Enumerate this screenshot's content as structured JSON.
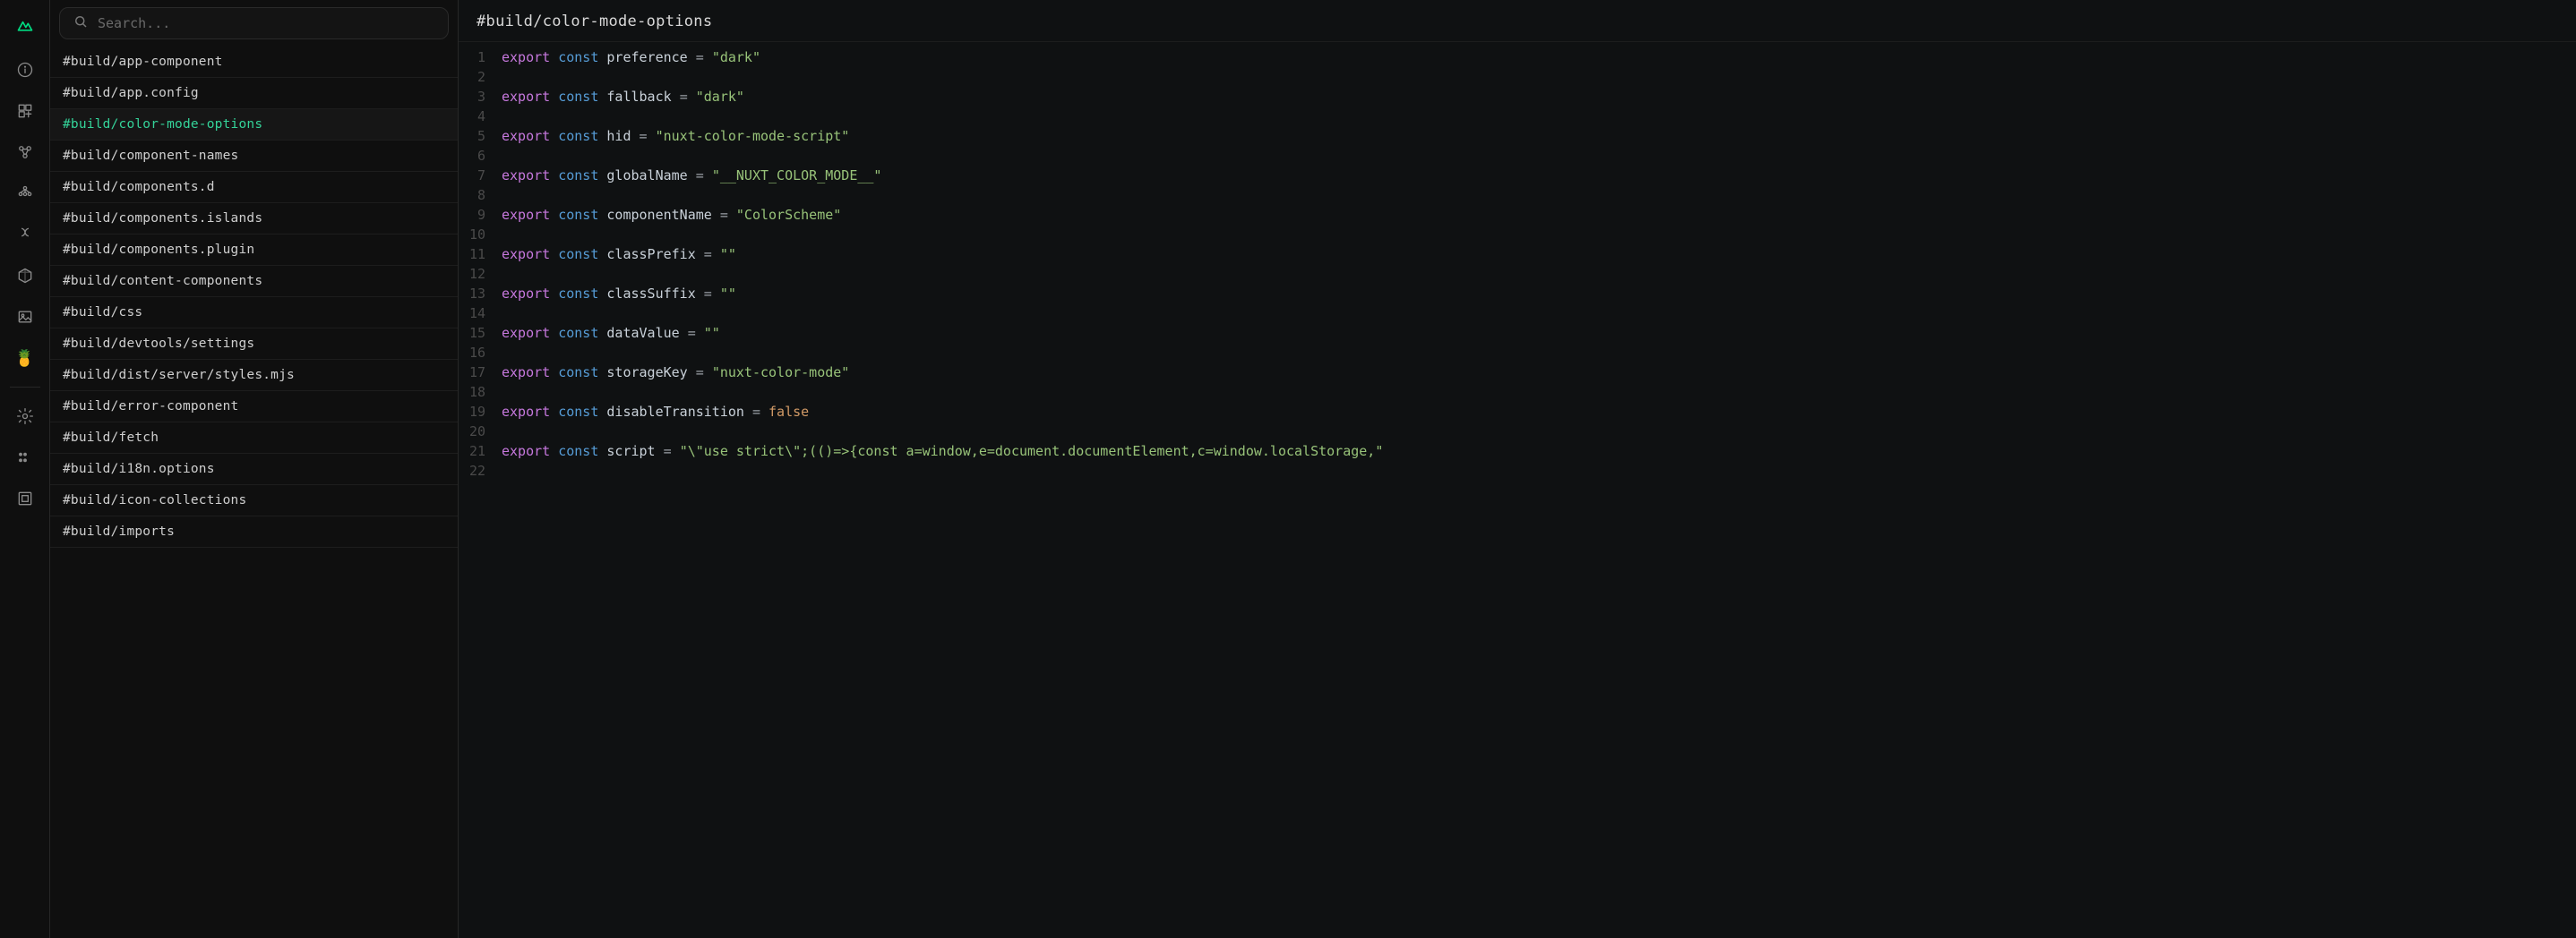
{
  "search": {
    "placeholder": "Search..."
  },
  "rail": {
    "items": [
      {
        "name": "info-icon"
      },
      {
        "name": "pages-icon"
      },
      {
        "name": "components-icon"
      },
      {
        "name": "modules-icon"
      },
      {
        "name": "hooks-icon"
      },
      {
        "name": "files-icon"
      },
      {
        "name": "assets-icon"
      },
      {
        "name": "pinia-icon"
      }
    ],
    "bottom": [
      {
        "name": "settings-icon"
      },
      {
        "name": "more-icon"
      },
      {
        "name": "inspect-icon"
      }
    ]
  },
  "files": [
    {
      "label": "#build/app-component",
      "active": false
    },
    {
      "label": "#build/app.config",
      "active": false
    },
    {
      "label": "#build/color-mode-options",
      "active": true
    },
    {
      "label": "#build/component-names",
      "active": false
    },
    {
      "label": "#build/components.d",
      "active": false
    },
    {
      "label": "#build/components.islands",
      "active": false
    },
    {
      "label": "#build/components.plugin",
      "active": false
    },
    {
      "label": "#build/content-components",
      "active": false
    },
    {
      "label": "#build/css",
      "active": false
    },
    {
      "label": "#build/devtools/settings",
      "active": false
    },
    {
      "label": "#build/dist/server/styles.mjs",
      "active": false
    },
    {
      "label": "#build/error-component",
      "active": false
    },
    {
      "label": "#build/fetch",
      "active": false
    },
    {
      "label": "#build/i18n.options",
      "active": false
    },
    {
      "label": "#build/icon-collections",
      "active": false
    },
    {
      "label": "#build/imports",
      "active": false
    }
  ],
  "breadcrumb": "#build/color-mode-options",
  "code": {
    "declarations": [
      {
        "name": "preference",
        "type": "string",
        "value": "dark"
      },
      {
        "name": "fallback",
        "type": "string",
        "value": "dark"
      },
      {
        "name": "hid",
        "type": "string",
        "value": "nuxt-color-mode-script"
      },
      {
        "name": "globalName",
        "type": "string",
        "value": "__NUXT_COLOR_MODE__"
      },
      {
        "name": "componentName",
        "type": "string",
        "value": "ColorScheme"
      },
      {
        "name": "classPrefix",
        "type": "string",
        "value": ""
      },
      {
        "name": "classSuffix",
        "type": "string",
        "value": ""
      },
      {
        "name": "dataValue",
        "type": "string",
        "value": ""
      },
      {
        "name": "storageKey",
        "type": "string",
        "value": "nuxt-color-mode"
      },
      {
        "name": "disableTransition",
        "type": "bool",
        "value": "false"
      },
      {
        "name": "script",
        "type": "string",
        "value": "\\\"use strict\\\";(()=>{const a=window,e=document.documentElement,c=window.localStorage,"
      }
    ],
    "total_lines": 22
  }
}
